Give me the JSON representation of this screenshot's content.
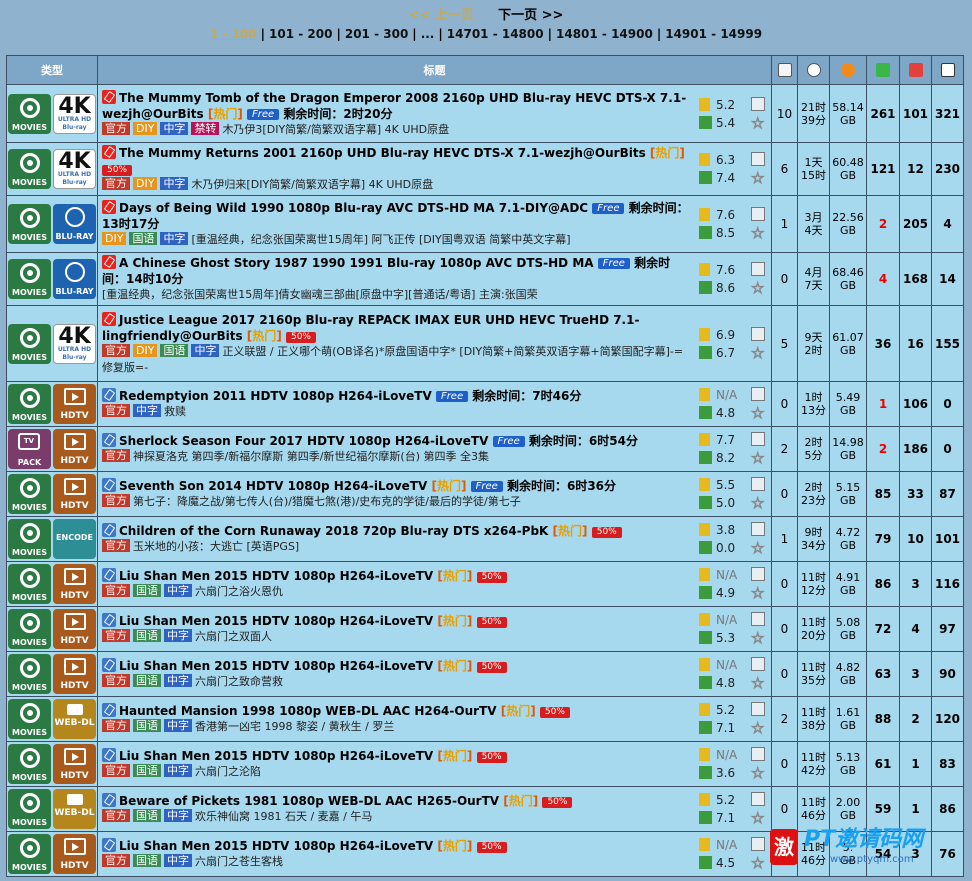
{
  "pager": {
    "prev": "<< 上一页",
    "next": "下一页 >>",
    "pages": [
      "1 - 100",
      "101 - 200",
      "201 - 300",
      "...",
      "14701 - 14800",
      "14801 - 14900",
      "14901 - 14999"
    ]
  },
  "header": {
    "type": "类型",
    "title": "标题"
  },
  "rows": [
    {
      "cat": [
        "movies",
        "4k"
      ],
      "pin": true,
      "title": "The Mummy Tomb of the Dragon Emperor 2008 2160p UHD Blu-ray HEVC DTS-X 7.1-wezjh@OurBits",
      "hot": "热门",
      "free": "Free",
      "pct": "",
      "remain": "剩余时间：2时20分",
      "tags": [
        "官方",
        "DIY",
        "中字",
        "禁转"
      ],
      "desc": "木乃伊3[DIY简繁/简繁双语字幕] 4K UHD原盘",
      "imdb": "5.2",
      "douban": "5.4",
      "comments": "10",
      "age": "21时\n39分",
      "size": "58.14\nGB",
      "seeders": "261",
      "leechers": "101",
      "done": "321",
      "red": false
    },
    {
      "cat": [
        "movies",
        "4k"
      ],
      "pin": true,
      "title": "The Mummy Returns 2001 2160p UHD Blu-ray HEVC DTS-X 7.1-wezjh@OurBits",
      "hot": "热门",
      "free": "",
      "pct": "50%",
      "remain": "",
      "tags": [
        "官方",
        "DIY",
        "中字"
      ],
      "desc": "木乃伊归来[DIY简繁/简繁双语字幕] 4K UHD原盘",
      "imdb": "6.3",
      "douban": "7.4",
      "comments": "6",
      "age": "1天\n15时",
      "size": "60.48\nGB",
      "seeders": "121",
      "leechers": "12",
      "done": "230",
      "red": false
    },
    {
      "cat": [
        "movies",
        "bluray"
      ],
      "pin": true,
      "title": "Days of Being Wild 1990 1080p Blu-ray AVC DTS-HD MA 7.1-DIY@ADC",
      "hot": "",
      "free": "Free",
      "pct": "",
      "remain": "剩余时间：13时17分",
      "tags": [
        "DIY",
        "国语",
        "中字"
      ],
      "desc": "[重温经典，纪念张国荣离世15周年] 阿飞正传 [DIY国粤双语 简繁中英文字幕]",
      "imdb": "7.6",
      "douban": "8.5",
      "comments": "1",
      "age": "3月\n4天",
      "size": "22.56\nGB",
      "seeders": "2",
      "leechers": "205",
      "done": "4",
      "red": true
    },
    {
      "cat": [
        "movies",
        "bluray"
      ],
      "pin": true,
      "title": "A Chinese Ghost Story 1987 1990 1991 Blu-ray 1080p AVC DTS-HD MA",
      "hot": "",
      "free": "Free",
      "pct": "",
      "remain": "剩余时间：14时10分",
      "tags": [],
      "desc": "[重温经典，纪念张国荣离世15周年]倩女幽魂三部曲[原盘中字][普通话/粤语] 主演:张国荣",
      "imdb": "7.6",
      "douban": "8.6",
      "comments": "0",
      "age": "4月\n7天",
      "size": "68.46\nGB",
      "seeders": "4",
      "leechers": "168",
      "done": "14",
      "red": true
    },
    {
      "cat": [
        "movies",
        "4k"
      ],
      "pin": true,
      "title": "Justice League 2017 2160p Blu-ray REPACK IMAX EUR UHD HEVC TrueHD 7.1-lingfriendly@OurBits",
      "hot": "热门",
      "free": "",
      "pct": "50%",
      "remain": "",
      "tags": [
        "官方",
        "DIY",
        "国语",
        "中字"
      ],
      "desc": "正义联盟 / 正义哪个萌(OB译名)*原盘国语中字* [DIY简繁+简繁英双语字幕+简繁国配字幕]-=修复版=-",
      "imdb": "6.9",
      "douban": "6.7",
      "comments": "5",
      "age": "9天\n2时",
      "size": "61.07\nGB",
      "seeders": "36",
      "leechers": "16",
      "done": "155",
      "red": false
    },
    {
      "cat": [
        "movies",
        "hdtv"
      ],
      "pin": false,
      "title": "Redemptyion 2011 HDTV 1080p H264-iLoveTV",
      "hot": "",
      "free": "Free",
      "pct": "",
      "remain": "剩余时间：7时46分",
      "tags": [
        "官方",
        "中字"
      ],
      "desc": "救赎",
      "imdb": "N/A",
      "douban": "4.8",
      "comments": "0",
      "age": "1时\n13分",
      "size": "5.49\nGB",
      "seeders": "1",
      "leechers": "106",
      "done": "0",
      "red": true
    },
    {
      "cat": [
        "pack",
        "hdtv"
      ],
      "pin": false,
      "title": "Sherlock Season Four 2017 HDTV 1080p H264-iLoveTV",
      "hot": "",
      "free": "Free",
      "pct": "",
      "remain": "剩余时间：6时54分",
      "tags": [
        "官方"
      ],
      "desc": "神探夏洛克 第四季/新福尔摩斯 第四季/新世纪福尔摩斯(台) 第四季 全3集",
      "imdb": "7.7",
      "douban": "8.2",
      "comments": "2",
      "age": "2时\n5分",
      "size": "14.98\nGB",
      "seeders": "2",
      "leechers": "186",
      "done": "0",
      "red": true
    },
    {
      "cat": [
        "movies",
        "hdtv"
      ],
      "pin": false,
      "title": "Seventh Son 2014 HDTV 1080p H264-iLoveTV",
      "hot": "热门",
      "free": "Free",
      "pct": "",
      "remain": "剩余时间：6时36分",
      "tags": [
        "官方"
      ],
      "desc": "第七子：降魔之战/第七传人(台)/猎魔七煞(港)/史布克的学徒/最后的学徒/第七子",
      "imdb": "5.5",
      "douban": "5.0",
      "comments": "0",
      "age": "2时\n23分",
      "size": "5.15\nGB",
      "seeders": "85",
      "leechers": "33",
      "done": "87",
      "red": false
    },
    {
      "cat": [
        "movies",
        "encode"
      ],
      "pin": false,
      "title": "Children of the Corn Runaway 2018 720p Blu-ray DTS x264-PbK",
      "hot": "热门",
      "free": "",
      "pct": "50%",
      "remain": "",
      "tags": [
        "官方"
      ],
      "desc": "玉米地的小孩：大逃亡 [英语PGS]",
      "imdb": "3.8",
      "douban": "0.0",
      "comments": "1",
      "age": "9时\n34分",
      "size": "4.72\nGB",
      "seeders": "79",
      "leechers": "10",
      "done": "101",
      "red": false
    },
    {
      "cat": [
        "movies",
        "hdtv"
      ],
      "pin": false,
      "title": "Liu Shan Men 2015 HDTV 1080p H264-iLoveTV",
      "hot": "热门",
      "free": "",
      "pct": "50%",
      "remain": "",
      "tags": [
        "官方",
        "国语",
        "中字"
      ],
      "desc": "六扇门之浴火恩仇",
      "imdb": "N/A",
      "douban": "4.9",
      "comments": "0",
      "age": "11时\n12分",
      "size": "4.91\nGB",
      "seeders": "86",
      "leechers": "3",
      "done": "116",
      "red": false
    },
    {
      "cat": [
        "movies",
        "hdtv"
      ],
      "pin": false,
      "title": "Liu Shan Men 2015 HDTV 1080p H264-iLoveTV",
      "hot": "热门",
      "free": "",
      "pct": "50%",
      "remain": "",
      "tags": [
        "官方",
        "国语",
        "中字"
      ],
      "desc": "六扇门之双面人",
      "imdb": "N/A",
      "douban": "5.3",
      "comments": "0",
      "age": "11时\n20分",
      "size": "5.08\nGB",
      "seeders": "72",
      "leechers": "4",
      "done": "97",
      "red": false
    },
    {
      "cat": [
        "movies",
        "hdtv"
      ],
      "pin": false,
      "title": "Liu Shan Men 2015 HDTV 1080p H264-iLoveTV",
      "hot": "热门",
      "free": "",
      "pct": "50%",
      "remain": "",
      "tags": [
        "官方",
        "国语",
        "中字"
      ],
      "desc": "六扇门之致命营救",
      "imdb": "N/A",
      "douban": "4.8",
      "comments": "0",
      "age": "11时\n35分",
      "size": "4.82\nGB",
      "seeders": "63",
      "leechers": "3",
      "done": "90",
      "red": false
    },
    {
      "cat": [
        "movies",
        "webdl"
      ],
      "pin": false,
      "title": "Haunted Mansion 1998 1080p WEB-DL AAC H264-OurTV",
      "hot": "热门",
      "free": "",
      "pct": "50%",
      "remain": "",
      "tags": [
        "官方",
        "国语",
        "中字"
      ],
      "desc": "香港第一凶宅 1998 黎姿 / 黄秋生 / 罗兰",
      "imdb": "5.2",
      "douban": "7.1",
      "comments": "2",
      "age": "11时\n38分",
      "size": "1.61\nGB",
      "seeders": "88",
      "leechers": "2",
      "done": "120",
      "red": false
    },
    {
      "cat": [
        "movies",
        "hdtv"
      ],
      "pin": false,
      "title": "Liu Shan Men 2015 HDTV 1080p H264-iLoveTV",
      "hot": "热门",
      "free": "",
      "pct": "50%",
      "remain": "",
      "tags": [
        "官方",
        "国语",
        "中字"
      ],
      "desc": "六扇门之沦陷",
      "imdb": "N/A",
      "douban": "3.6",
      "comments": "0",
      "age": "11时\n42分",
      "size": "5.13\nGB",
      "seeders": "61",
      "leechers": "1",
      "done": "83",
      "red": false
    },
    {
      "cat": [
        "movies",
        "webdl"
      ],
      "pin": false,
      "title": "Beware of Pickets 1981 1080p WEB-DL AAC H265-OurTV",
      "hot": "热门",
      "free": "",
      "pct": "50%",
      "remain": "",
      "tags": [
        "官方",
        "国语",
        "中字"
      ],
      "desc": "欢乐神仙窝 1981 石天 / 麦嘉 / 午马",
      "imdb": "5.2",
      "douban": "7.1",
      "comments": "0",
      "age": "11时\n46分",
      "size": "2.00\nGB",
      "seeders": "59",
      "leechers": "1",
      "done": "86",
      "red": false
    },
    {
      "cat": [
        "movies",
        "hdtv"
      ],
      "pin": false,
      "title": "Liu Shan Men 2015 HDTV 1080p H264-iLoveTV",
      "hot": "热门",
      "free": "",
      "pct": "50%",
      "remain": "",
      "tags": [
        "官方",
        "国语",
        "中字"
      ],
      "desc": "六扇门之苍生客栈",
      "imdb": "N/A",
      "douban": "4.5",
      "comments": "0",
      "age": "11时\n46分",
      "size": "5.\nGB",
      "seeders": "54",
      "leechers": "3",
      "done": "76",
      "red": false
    }
  ],
  "watermark": {
    "brand": "PT邀请码网",
    "url": "www.ptyqm.com",
    "mark": "激"
  },
  "colors": {
    "background": "#8fb3cf",
    "row": "#a6d8ee",
    "header": "#7ea6c6",
    "red": "#e00000"
  }
}
